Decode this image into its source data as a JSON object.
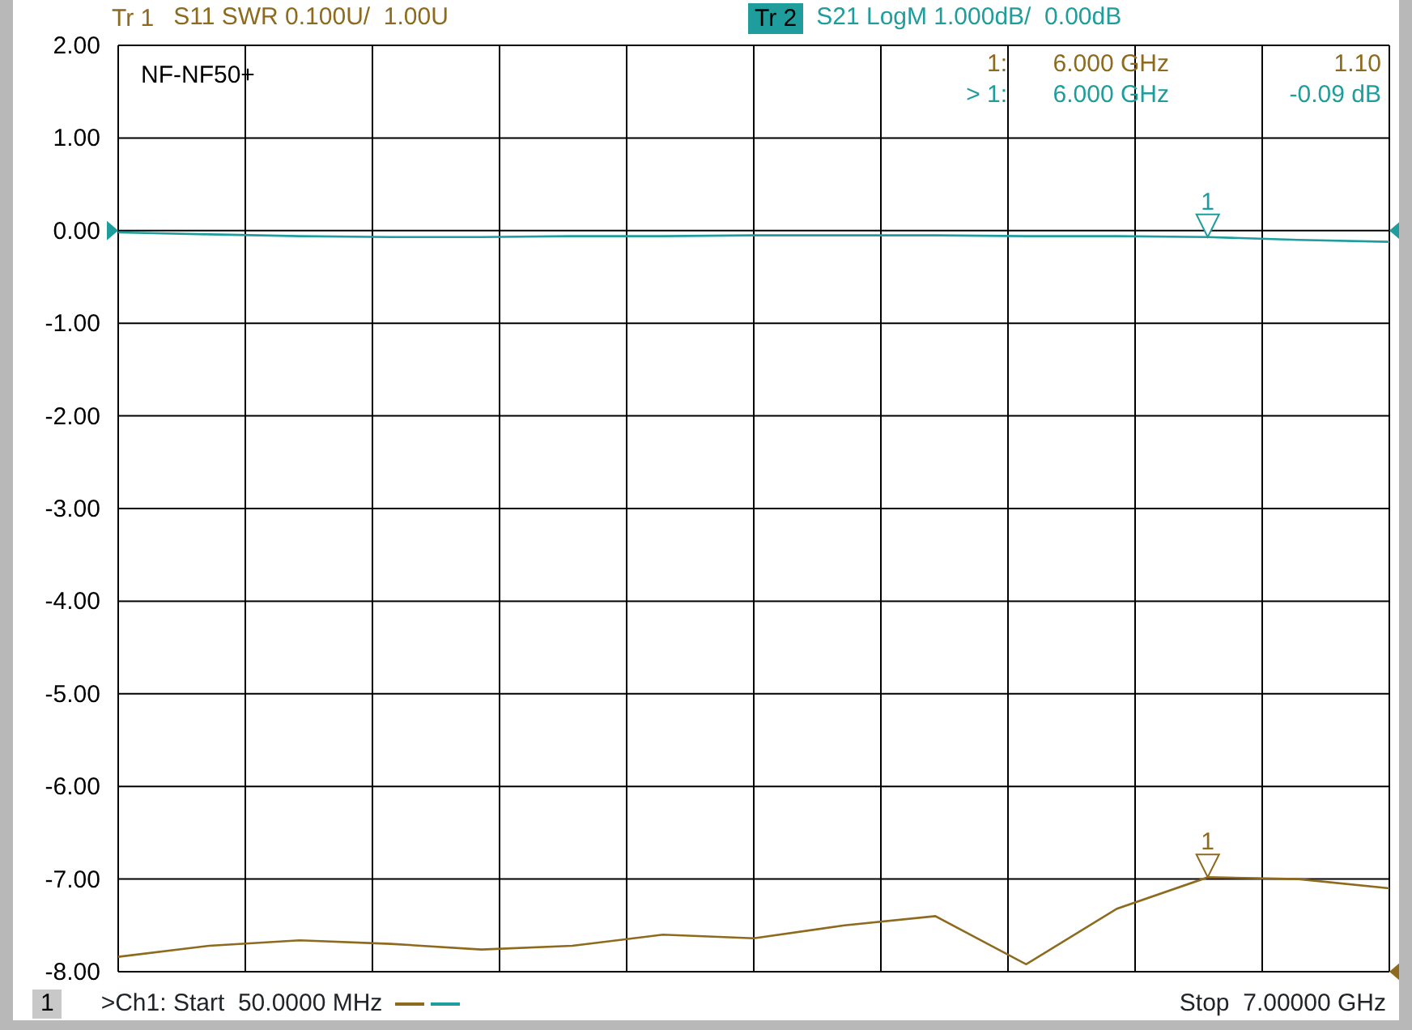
{
  "traces": [
    {
      "label": "Tr 1",
      "setting": "S11 SWR 0.100U/  1.00U",
      "color": "#8d6a1e",
      "selected": false
    },
    {
      "label": "Tr 2",
      "setting": "S21 LogM 1.000dB/  0.00dB",
      "color": "#1f9c9c",
      "selected": true
    }
  ],
  "plot": {
    "title": "NF-NF50+",
    "readouts": [
      {
        "marker": "1:",
        "frequency": "6.000 GHz",
        "value": "1.10",
        "color": "#8d6a1e"
      },
      {
        "marker": "> 1:",
        "frequency": "6.000 GHz",
        "value": "-0.09 dB",
        "color": "#1f9c9c"
      }
    ],
    "chart_data": {
      "type": "line",
      "ylim": [
        -8,
        2
      ],
      "grid": true,
      "yticks": [
        {
          "value": 2,
          "label": "2.00"
        },
        {
          "value": 1,
          "label": "1.00"
        },
        {
          "value": 0,
          "label": "0.00"
        },
        {
          "value": -1,
          "label": "-1.00"
        },
        {
          "value": -2,
          "label": "-2.00"
        },
        {
          "value": -3,
          "label": "-3.00"
        },
        {
          "value": -4,
          "label": "-4.00"
        },
        {
          "value": -5,
          "label": "-5.00"
        },
        {
          "value": -6,
          "label": "-6.00"
        },
        {
          "value": -7,
          "label": "-7.00"
        },
        {
          "value": -8,
          "label": "-8.00"
        }
      ],
      "categories": [
        null,
        null,
        null,
        null,
        null,
        null,
        null,
        null,
        null,
        null,
        null,
        null,
        null,
        null,
        null
      ],
      "series": [
        {
          "color": "#8d6a1e",
          "values": [
            -7.84,
            -7.72,
            -7.66,
            -7.7,
            -7.76,
            -7.72,
            -7.6,
            -7.64,
            -7.5,
            -7.4,
            -7.92,
            -7.32,
            -6.98,
            -7.0,
            -7.1
          ]
        },
        {
          "color": "#1f9c9c",
          "values": [
            -0.02,
            -0.04,
            -0.06,
            -0.07,
            -0.07,
            -0.06,
            -0.06,
            -0.05,
            -0.05,
            -0.05,
            -0.06,
            -0.06,
            -0.07,
            -0.1,
            -0.12
          ]
        }
      ],
      "annotations": [
        {
          "text": "1",
          "y": -6.98
        },
        {
          "text": "1",
          "y": -0.07
        }
      ]
    }
  },
  "status_bar": {
    "channel": "1",
    "start": ">Ch1: Start  50.0000 MHz",
    "stop": "Stop  7.00000 GHz"
  }
}
